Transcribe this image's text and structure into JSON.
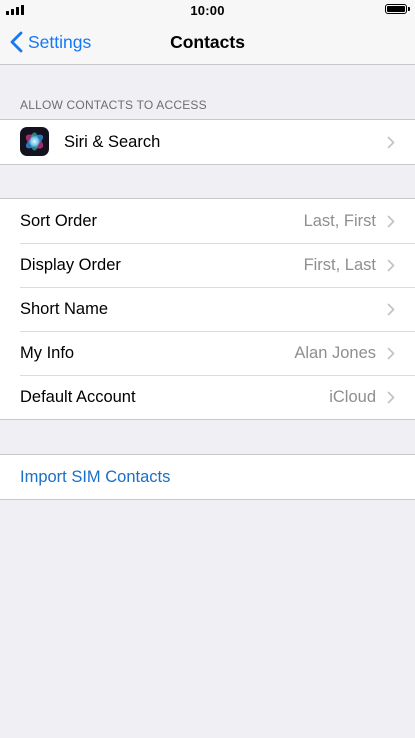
{
  "status_bar": {
    "time": "10:00"
  },
  "nav": {
    "back_label": "Settings",
    "title": "Contacts"
  },
  "allow_section": {
    "header": "ALLOW CONTACTS TO ACCESS",
    "items": [
      {
        "label": "Siri & Search",
        "icon": "siri-icon"
      }
    ]
  },
  "settings": {
    "items": [
      {
        "label": "Sort Order",
        "value": "Last, First"
      },
      {
        "label": "Display Order",
        "value": "First, Last"
      },
      {
        "label": "Short Name",
        "value": ""
      },
      {
        "label": "My Info",
        "value": "Alan Jones"
      },
      {
        "label": "Default Account",
        "value": "iCloud"
      }
    ]
  },
  "import": {
    "label": "Import SIM Contacts"
  },
  "colors": {
    "accent": "#1479f6",
    "link": "#1a6fc7",
    "background": "#efeff4",
    "secondary_text": "#8e8e93"
  }
}
